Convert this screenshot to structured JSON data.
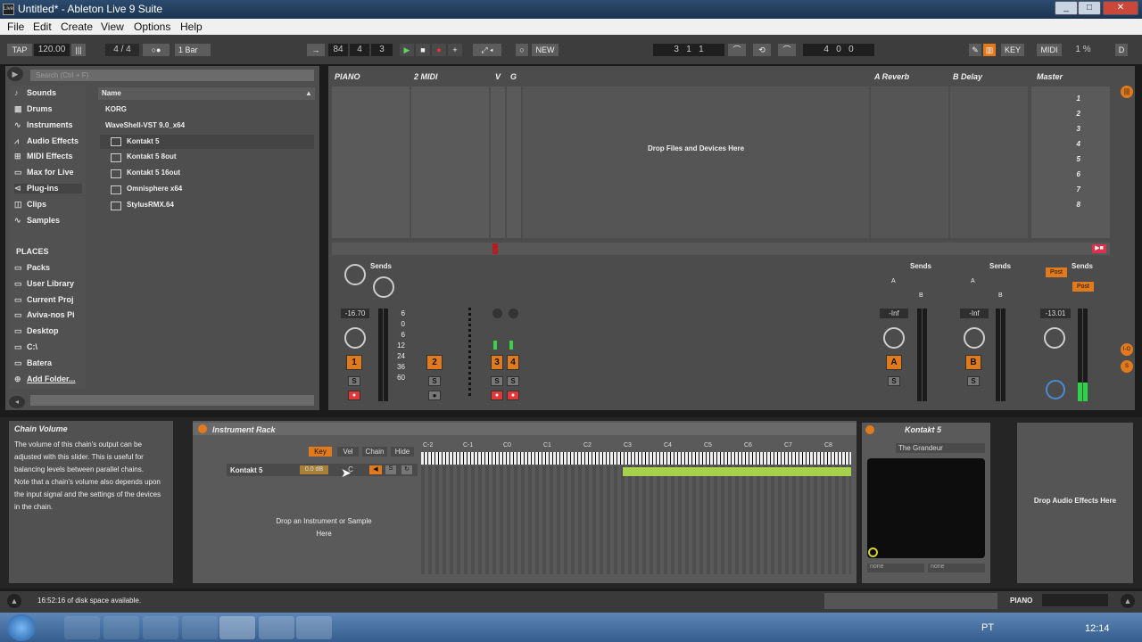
{
  "window": {
    "title": "Untitled* - Ableton Live 9 Suite",
    "app_icon": "Live",
    "controls": [
      "_",
      "□",
      "✕"
    ]
  },
  "menu": [
    "File",
    "Edit",
    "Create",
    "View",
    "Options",
    "Help"
  ],
  "control_bar": {
    "tap": "TAP",
    "tempo": "120.00",
    "meter": "4 / 4",
    "quantize": "1 Bar",
    "position": [
      "84",
      "4",
      "3"
    ],
    "new_label": "NEW",
    "loop_start": [
      "3",
      "1",
      "1"
    ],
    "loop_length": [
      "4",
      "0",
      "0"
    ],
    "key": "KEY",
    "midi": "MIDI",
    "cpu": "1 %",
    "d": "D"
  },
  "browser": {
    "search_placeholder": "Search (Ctrl + F)",
    "categories": [
      "Sounds",
      "Drums",
      "Instruments",
      "Audio Effects",
      "MIDI Effects",
      "Max for Live",
      "Plug-ins",
      "Clips",
      "Samples"
    ],
    "places_title": "PLACES",
    "places": [
      "Packs",
      "User Library",
      "Current Proj",
      "Aviva-nos Pi",
      "Desktop",
      "C:\\",
      "Batera",
      "Add Folder..."
    ],
    "column_header": "Name",
    "items": [
      "KORG",
      "WaveShell-VST 9.0_x64",
      "Kontakt 5",
      "Kontakt 5 8out",
      "Kontakt 5 16out",
      "Omnisphere x64",
      "StylusRMX.64"
    ]
  },
  "session": {
    "tracks": [
      {
        "name": "PIANO",
        "volume": "-16.70",
        "number": "1"
      },
      {
        "name": "2 MIDI",
        "number": "2"
      },
      {
        "name": "V",
        "number": "3"
      },
      {
        "name": "G",
        "number": "4"
      }
    ],
    "drop_text": "Drop Files and Devices Here",
    "returns": [
      {
        "name": "A Reverb",
        "volume": "-Inf",
        "letter": "A"
      },
      {
        "name": "B Delay",
        "volume": "-Inf",
        "letter": "B"
      }
    ],
    "master": {
      "name": "Master",
      "volume": "-13.01",
      "scenes": [
        "1",
        "2",
        "3",
        "4",
        "5",
        "6",
        "7",
        "8"
      ],
      "post": "Post"
    },
    "sends_label": "Sends",
    "send_a": "A",
    "send_b": "B",
    "db_scale": [
      "6",
      "0",
      "6",
      "12",
      "24",
      "36",
      "60"
    ],
    "solo": "S"
  },
  "info_view": {
    "title": "Chain Volume",
    "text": "The volume of this chain's output can be adjusted with this slider. This is useful for balancing levels between parallel chains.\nNote that a chain's volume also depends upon the input signal and the settings of the devices in the chain."
  },
  "device": {
    "rack_title": "Instrument Rack",
    "tabs": [
      "Key",
      "Vel",
      "Chain",
      "Hide"
    ],
    "chain_name": "Kontakt 5",
    "chain_volume": "0.0 dB",
    "chain_pan": "C",
    "drop_instrument": "Drop an Instrument or Sample Here",
    "octaves": [
      "C-2",
      "C-1",
      "C0",
      "C1",
      "C2",
      "C3",
      "C4",
      "C5",
      "C6",
      "C7",
      "C8"
    ],
    "plugin_title": "Kontakt 5",
    "preset": "The Grandeur",
    "xy_params": [
      "none",
      "none"
    ],
    "drop_effects": "Drop Audio Effects Here"
  },
  "status": {
    "message": "16:52:16 of disk space available.",
    "track": "PIANO"
  },
  "taskbar": {
    "lang": "PT",
    "clock": "12:14"
  }
}
